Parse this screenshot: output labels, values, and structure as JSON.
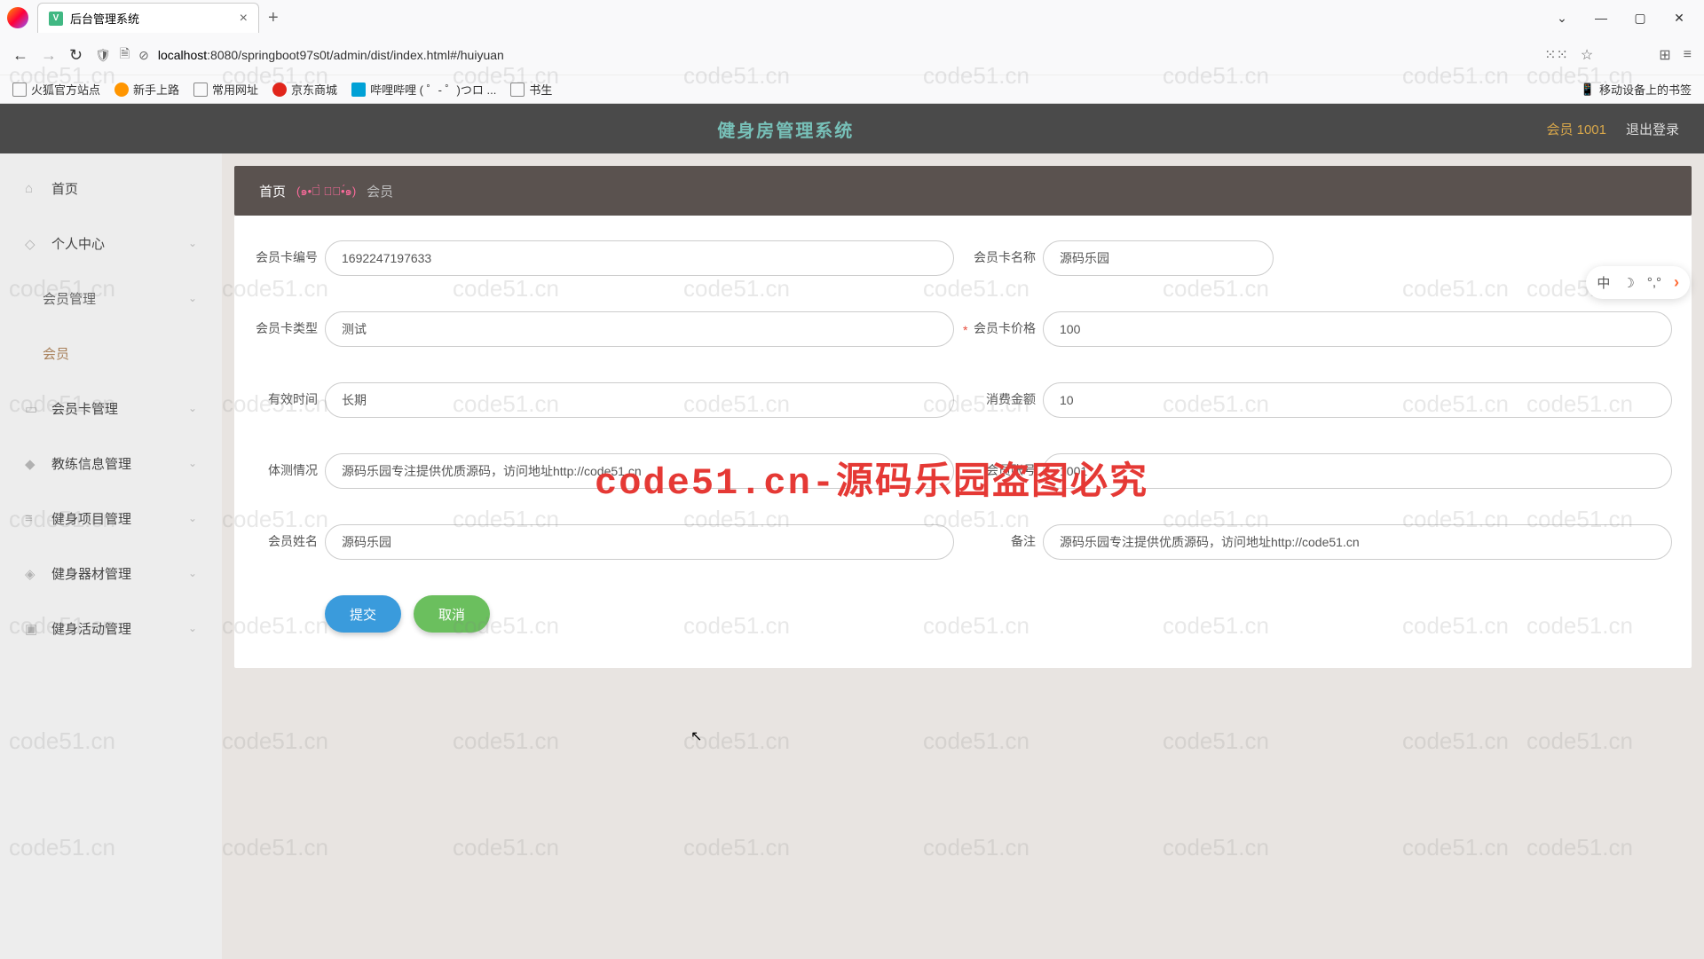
{
  "browser": {
    "tab_title": "后台管理系统",
    "url_host": "localhost",
    "url_rest": ":8080/springboot97s0t/admin/dist/index.html#/huiyuan",
    "bookmarks": [
      "火狐官方站点",
      "新手上路",
      "常用网址",
      "京东商城",
      "哔哩哔哩 ( ゜- ゜)つロ ...",
      "书生"
    ],
    "mobile_bm": "移动设备上的书签"
  },
  "header": {
    "title": "健身房管理系统",
    "user": "会员 1001",
    "logout": "退出登录"
  },
  "sidebar": [
    {
      "label": "首页",
      "sub": false
    },
    {
      "label": "个人中心",
      "sub": false,
      "arrow": true
    },
    {
      "label": "会员管理",
      "sub": true,
      "arrow": true
    },
    {
      "label": "会员",
      "sub": true,
      "active": true
    },
    {
      "label": "会员卡管理",
      "sub": false,
      "arrow": true
    },
    {
      "label": "教练信息管理",
      "sub": false,
      "arrow": true
    },
    {
      "label": "健身项目管理",
      "sub": false,
      "arrow": true
    },
    {
      "label": "健身器材管理",
      "sub": false,
      "arrow": true
    },
    {
      "label": "健身活动管理",
      "sub": false,
      "arrow": true
    }
  ],
  "breadcrumb": {
    "home": "首页",
    "emoji": "(๑•॒̀ ູ॒•́๑)",
    "current": "会员"
  },
  "form": {
    "card_no": {
      "label": "会员卡编号",
      "value": "1692247197633"
    },
    "card_name": {
      "label": "会员卡名称",
      "value": "源码乐园"
    },
    "card_type": {
      "label": "会员卡类型",
      "value": "测试"
    },
    "card_price": {
      "label": "会员卡价格",
      "value": "100"
    },
    "valid_time": {
      "label": "有效时间",
      "value": "长期"
    },
    "consume": {
      "label": "消费金额",
      "value": "10"
    },
    "body_test": {
      "label": "体测情况",
      "value": "源码乐园专注提供优质源码，访问地址http://code51.cn"
    },
    "account": {
      "label": "会员账号",
      "value": "1001"
    },
    "member_name": {
      "label": "会员姓名",
      "value": "源码乐园"
    },
    "remark": {
      "label": "备注",
      "value": "源码乐园专注提供优质源码，访问地址http://code51.cn"
    }
  },
  "buttons": {
    "submit": "提交",
    "cancel": "取消"
  },
  "watermark": {
    "small": "code51.cn",
    "big": "code51.cn-源码乐园盗图必究"
  },
  "float_toolbar": {
    "lang": "中"
  }
}
